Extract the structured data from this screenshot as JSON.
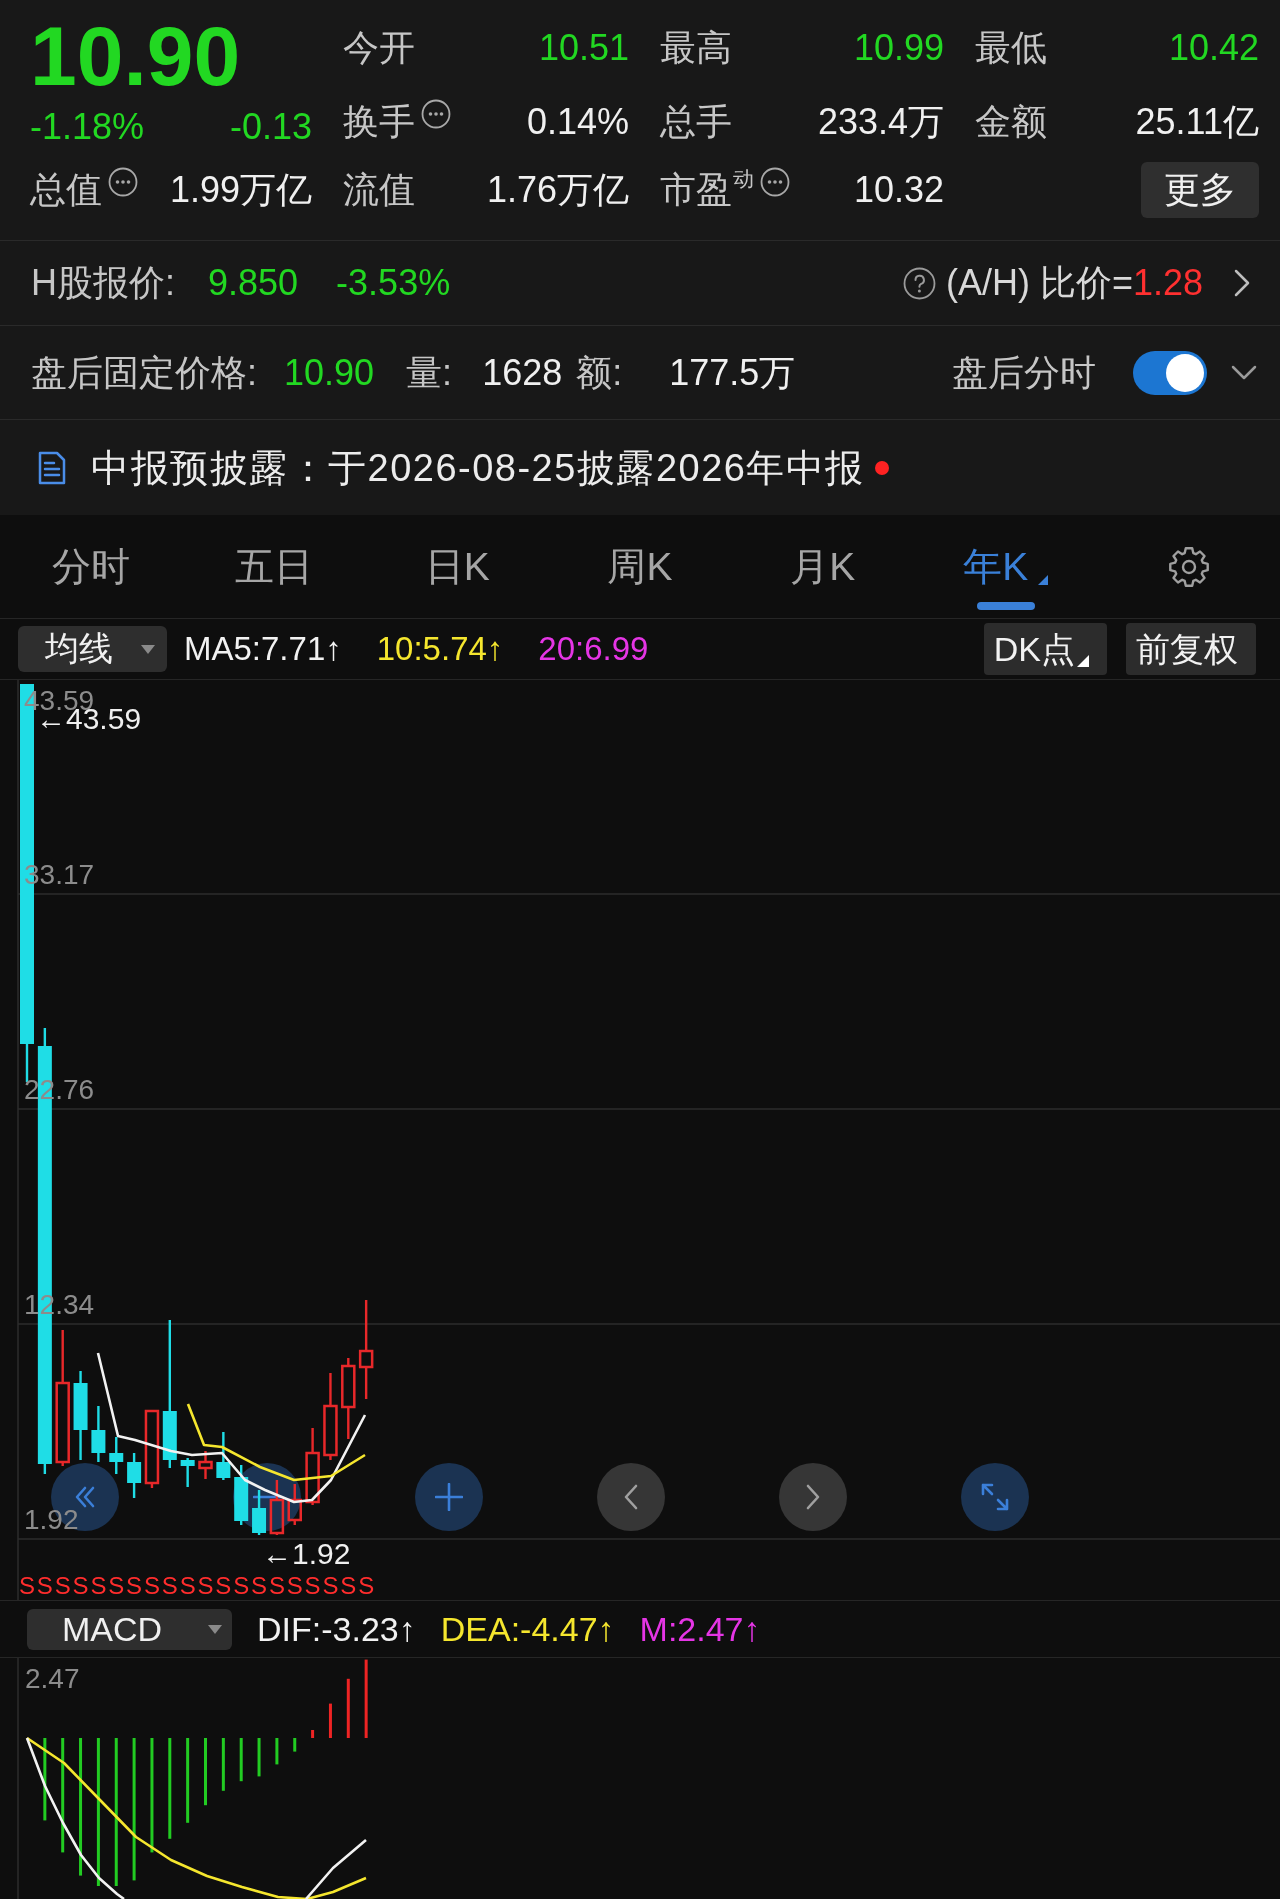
{
  "quote": {
    "price": "10.90",
    "falling": true,
    "change_percent": "-1.18%",
    "change": "-0.13",
    "market_value": {
      "label": "总值",
      "value": "1.99万亿",
      "info": true
    },
    "stats": [
      {
        "label": "今开",
        "value": "10.51",
        "falling": true,
        "info": false
      },
      {
        "label": "最高",
        "value": "10.99",
        "falling": true,
        "info": false
      },
      {
        "label": "最低",
        "value": "10.42",
        "falling": true,
        "info": false
      },
      {
        "label": "换手",
        "value": "0.14%",
        "falling": false,
        "info": true
      },
      {
        "label": "总手",
        "value": "233.4万",
        "falling": false,
        "info": false
      },
      {
        "label": "金额",
        "value": "25.11亿",
        "falling": false,
        "info": false
      },
      {
        "label": "流值",
        "value": "1.76万亿",
        "falling": false,
        "info": false
      },
      {
        "label": "市盈$^{动}$",
        "value": "10.32",
        "falling": false,
        "info": true
      }
    ],
    "more_button": "更多"
  },
  "h_share": {
    "label": "H股报价:",
    "price": "9.850",
    "change_percent": "-3.53%",
    "falling": true,
    "ratio_label": "(A/H) 比价=",
    "ratio": "1.28",
    "ratio_rising": true
  },
  "after_hours": {
    "label": "盘后固定价格:",
    "price": "10.90",
    "falling": true,
    "volume_label": "量:",
    "volume": "1628",
    "amount_label": "额:",
    "amount": "177.5万",
    "chart_toggle": {
      "label": "盘后分时",
      "on": true
    },
    "expanded": false
  },
  "notice": {
    "text": "中报预披露：于2026-08-25披露2026年中报",
    "unread": true
  },
  "tabs": [
    {
      "label": "分时",
      "selected": false
    },
    {
      "label": "五日",
      "selected": false
    },
    {
      "label": "日K",
      "selected": false
    },
    {
      "label": "周K",
      "selected": false
    },
    {
      "label": "月K",
      "selected": false
    },
    {
      "label": "年K",
      "selected": true
    }
  ],
  "indicator_bar": {
    "selector": "均线",
    "items": [
      {
        "text": "MA5:7.71↑",
        "color": "#f2f2f2"
      },
      {
        "text": "10:5.74↑",
        "color": "#f5e62e"
      },
      {
        "text": "20:6.99",
        "color": "#e535e5"
      }
    ],
    "buttons": [
      {
        "label": "DK点",
        "menu": true
      },
      {
        "label": "前复权",
        "menu": false
      }
    ]
  },
  "price_chart": {
    "y_labels": [
      "43.59",
      "33.17",
      "22.76",
      "12.34",
      "1.92"
    ],
    "high_label": "←43.59",
    "low_label": "←1.92",
    "signal_markers": [
      "S",
      "S",
      "S",
      "S",
      "S",
      "S",
      "S",
      "S",
      "S",
      "S",
      "S",
      "S",
      "S",
      "S",
      "S",
      "S",
      "S",
      "S",
      "S",
      "S"
    ]
  },
  "macd_bar": {
    "selector": "MACD",
    "items": [
      {
        "text": "DIF:-3.23↑",
        "color": "#f2f2f2"
      },
      {
        "text": "DEA:-4.47↑",
        "color": "#f5e62e"
      },
      {
        "text": "M:2.47↑",
        "color": "#e535e5"
      }
    ]
  },
  "macd_chart": {
    "y_label": "2.47"
  }
}
